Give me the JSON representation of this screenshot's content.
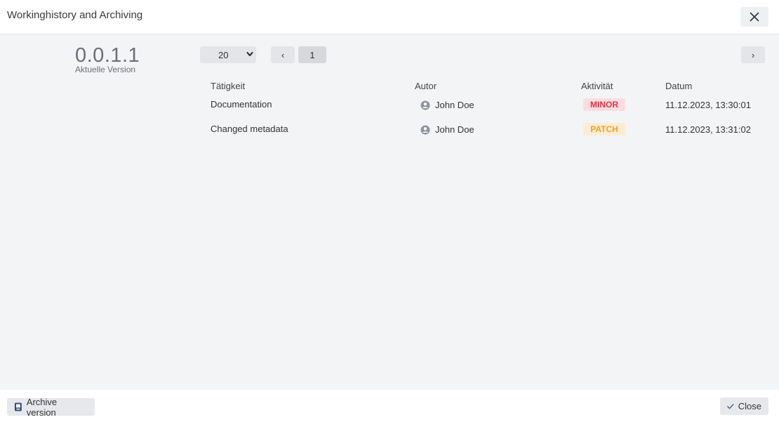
{
  "dialog": {
    "title": "Workinghistory and Archiving"
  },
  "version": {
    "number": "0.0.1.1",
    "label": "Aktuelle Version"
  },
  "pagination": {
    "page_size": "20",
    "prev_symbol": "‹",
    "next_symbol": "›",
    "current_page": "1"
  },
  "table": {
    "headers": {
      "activity": "Tätigkeit",
      "author": "Autor",
      "type": "Aktivität",
      "date": "Datum"
    },
    "rows": [
      {
        "activity": "Documentation",
        "author": "John Doe",
        "type": "MINOR",
        "date": "11.12.2023, 13:30:01"
      },
      {
        "activity": "Changed metadata",
        "author": "John Doe",
        "type": "PATCH",
        "date": "11.12.2023, 13:31:02"
      }
    ]
  },
  "footer": {
    "archive_label": "Archive version",
    "close_label": "Close"
  },
  "colors": {
    "minor": "#e0324a",
    "patch": "#efa22a",
    "body_bg": "#f3f4f6"
  }
}
